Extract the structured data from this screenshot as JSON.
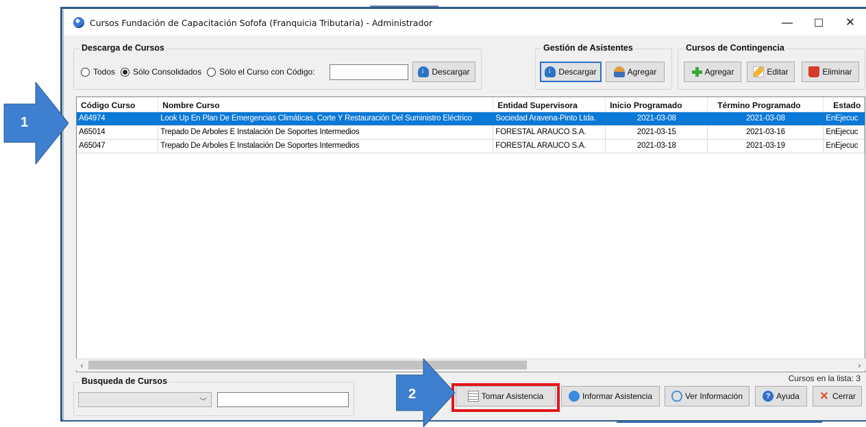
{
  "window": {
    "title": "Cursos Fundación de Capacitación Sofofa (Franquicia Tributaria) - Administrador",
    "controls": {
      "minimize": "—",
      "maximize": "☐",
      "close": "✕"
    }
  },
  "download_group": {
    "title": "Descarga de Cursos",
    "options": [
      "Todos",
      "Sólo Consolidados",
      "Sólo el Curso con Código:"
    ],
    "selected": "Sólo Consolidados",
    "code_value": "",
    "download_button": "Descargar"
  },
  "attendees_group": {
    "title": "Gestión de Asistentes",
    "download_button": "Descargar",
    "add_button": "Agregar"
  },
  "contingency_group": {
    "title": "Cursos de Contingencia",
    "add_button": "Agregar",
    "edit_button": "Editar",
    "delete_button": "Eliminar"
  },
  "grid": {
    "columns": [
      "Código Curso",
      "Nombre Curso",
      "Entidad Supervisora",
      "Inicio Programado",
      "Término Programado",
      "Estado"
    ],
    "rows": [
      [
        "A64974",
        "Look Up En Plan De Emergencias Climáticas, Corte Y Restauración Del Suministro Eléctrico",
        "Sociedad Aravena-Pinto Ltda.",
        "2021-03-08",
        "2021-03-08",
        "EnEjecuc"
      ],
      [
        "A65014",
        "Trepado De Arboles E Instalación De Soportes Intermedios",
        "FORESTAL ARAUCO S.A.",
        "2021-03-15",
        "2021-03-16",
        "EnEjecuc"
      ],
      [
        "A65047",
        "Trepado De Arboles E Instalación De Soportes Intermedios",
        "FORESTAL ARAUCO S.A.",
        "2021-03-18",
        "2021-03-19",
        "EnEjecuc"
      ]
    ],
    "selected_row": 0
  },
  "count_label": "Cursos en la lista: 3",
  "search_group": {
    "title": "Busqueda de Cursos",
    "combo_value": "",
    "text_value": ""
  },
  "bottom_buttons": {
    "take_attendance": "Tomar Asistencia",
    "report_attendance": "Informar Asistencia",
    "view_info": "Ver Información",
    "help": "Ayuda",
    "close": "Cerrar"
  },
  "annotations": {
    "callout_1": "1",
    "callout_2": "2",
    "highlight_color": "#e3161b",
    "arrow_color": "#3f7fd0"
  }
}
